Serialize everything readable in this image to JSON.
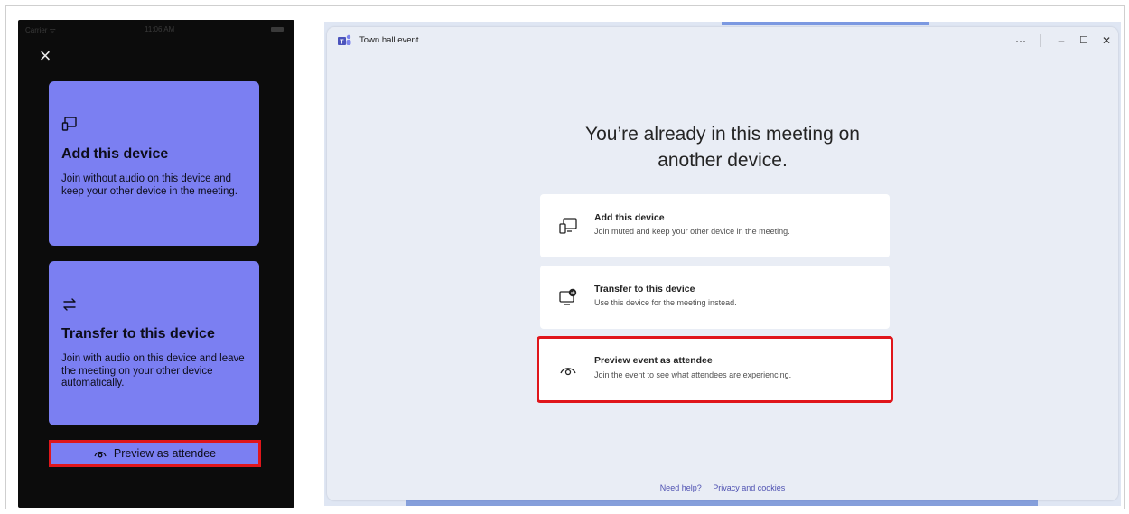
{
  "phone": {
    "status": {
      "carrier": "Carrier ᯤ",
      "time": "11:06 AM"
    },
    "close_icon": "close-icon",
    "cards": [
      {
        "icon": "add-device-icon",
        "title": "Add this device",
        "description": "Join without audio on this device and keep your other device in the meeting."
      },
      {
        "icon": "transfer-icon",
        "title": "Transfer to this device",
        "description": "Join with audio on this device and leave the meeting on your other device automatically."
      }
    ],
    "preview_button": {
      "icon": "eye-icon",
      "label": "Preview as attendee"
    }
  },
  "window": {
    "title": "Town hall event",
    "controls": {
      "more": "···",
      "minimize": "–",
      "maximize": "☐",
      "close": "✕"
    },
    "heading_line1": "You’re already in this meeting on",
    "heading_line2": "another device.",
    "options": [
      {
        "icon": "add-device-icon",
        "title": "Add this device",
        "description": "Join muted and keep your other device in the meeting."
      },
      {
        "icon": "transfer-icon",
        "title": "Transfer to this device",
        "description": "Use this device for the meeting instead."
      },
      {
        "icon": "eye-icon",
        "title": "Preview event as attendee",
        "description": "Join the event to see what attendees are experiencing.",
        "highlighted": true
      }
    ],
    "footer": {
      "help": "Need help?",
      "privacy": "Privacy and cookies"
    }
  },
  "colors": {
    "phone_card": "#7b7ff2",
    "highlight_border": "#e0161b",
    "link": "#4f52b2",
    "window_bg": "#e9edf5"
  }
}
